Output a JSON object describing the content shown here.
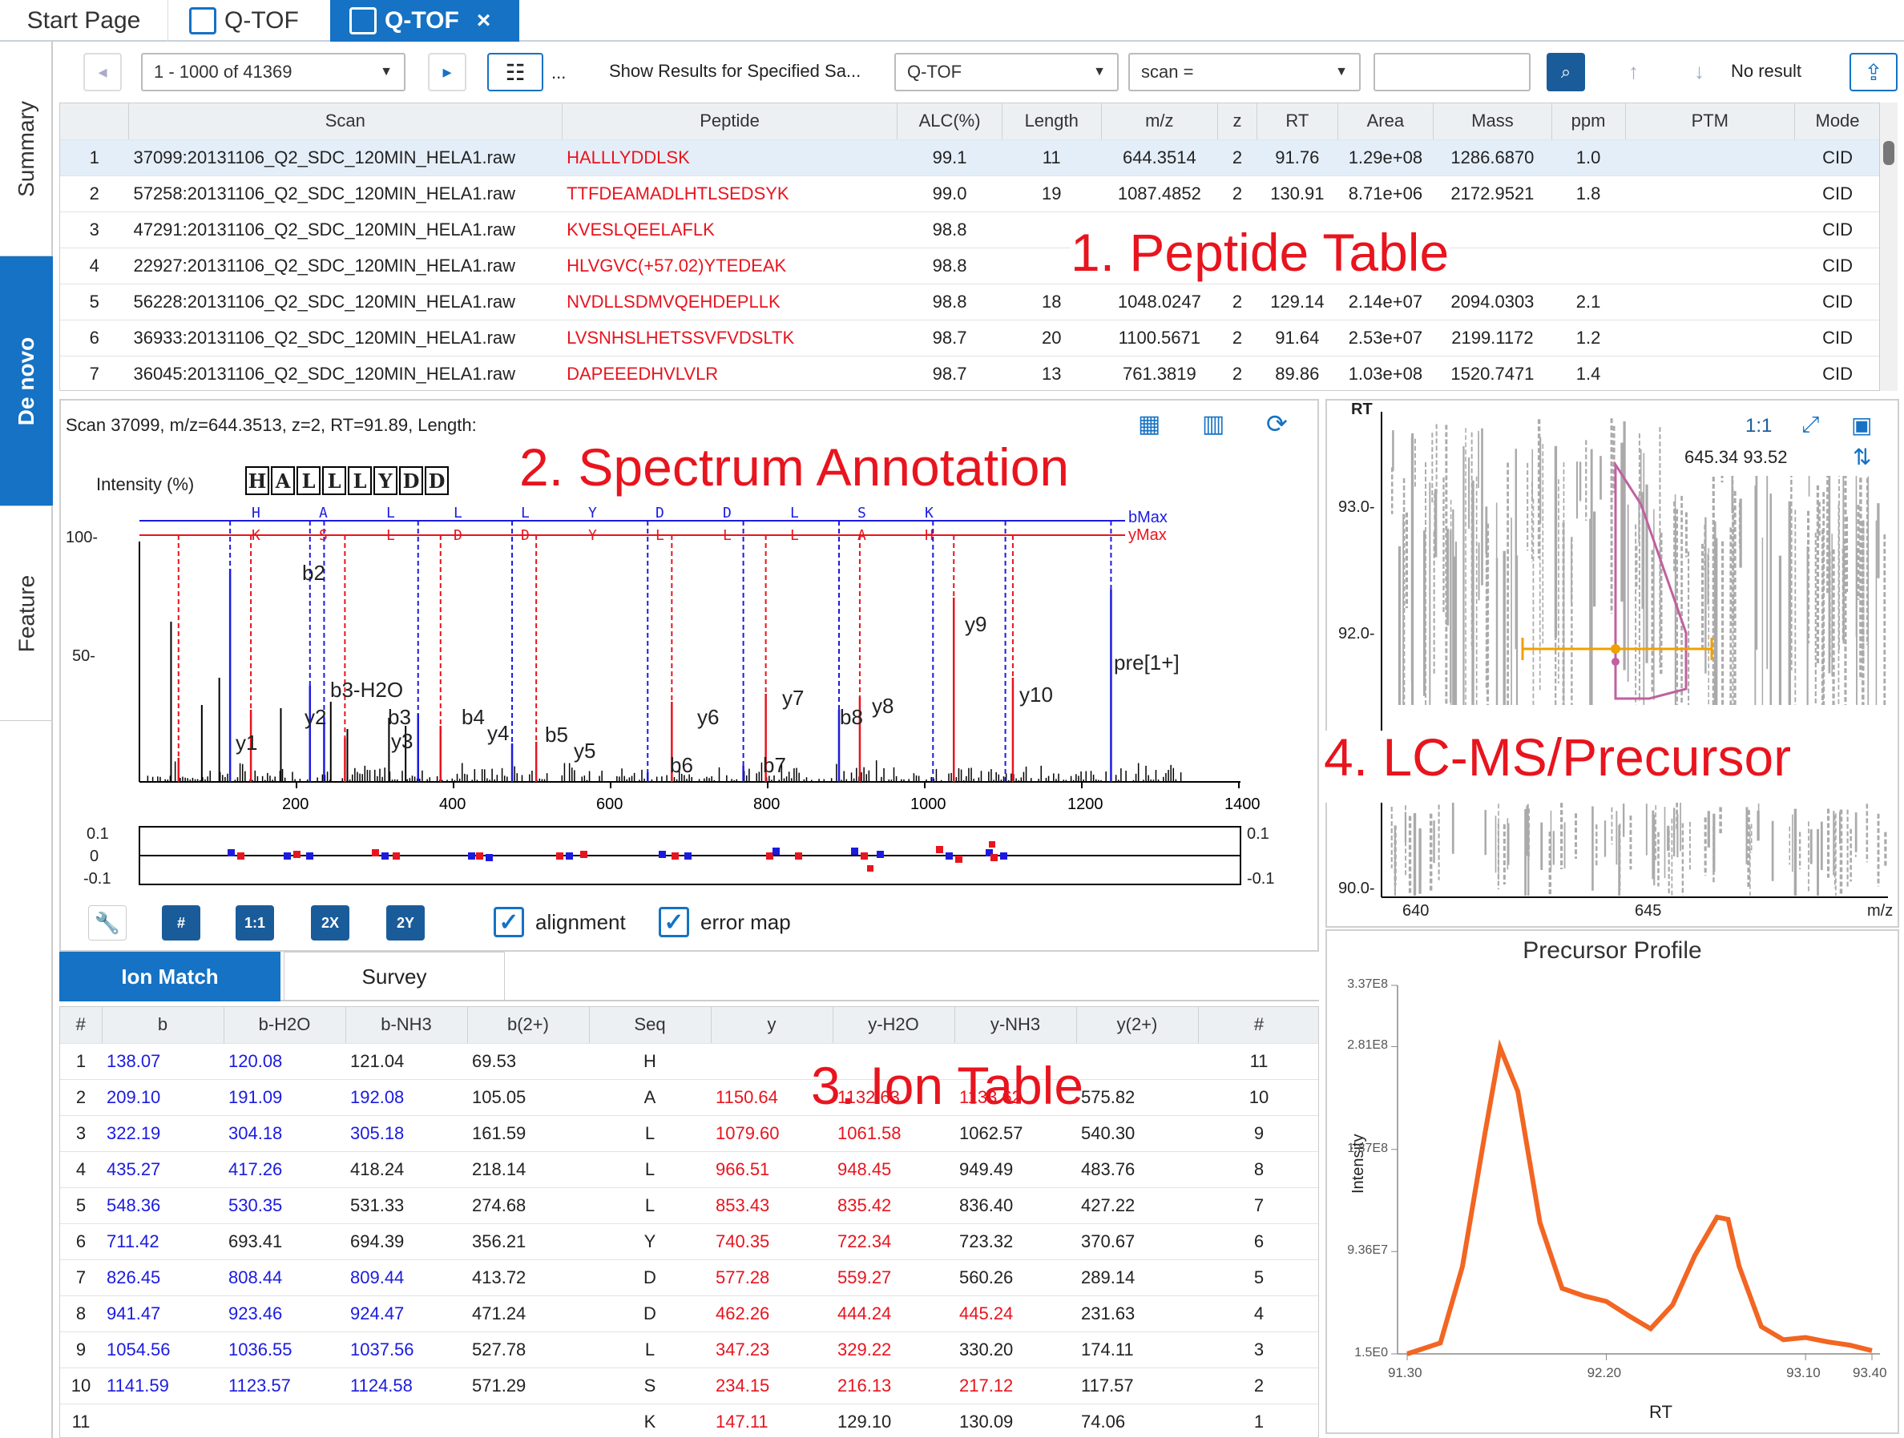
{
  "tabs": {
    "start": "Start Page",
    "qtof1": "Q-TOF",
    "qtof2": "Q-TOF",
    "close": "×"
  },
  "side": {
    "summary": "Summary",
    "denovo": "De novo",
    "feature": "Feature"
  },
  "toolbar": {
    "range": "1 - 1000 of 41369",
    "ellipsis": "...",
    "show_results": "Show Results for Specified Sa...",
    "sample": "Q-TOF",
    "filter": "scan =",
    "filter_value": "",
    "no_result": "No result"
  },
  "peptide_table": {
    "headers": [
      "",
      "Scan",
      "Peptide",
      "ALC(%)",
      "Length",
      "m/z",
      "z",
      "RT",
      "Area",
      "Mass",
      "ppm",
      "PTM",
      "Mode"
    ],
    "rows": [
      [
        "1",
        "37099:20131106_Q2_SDC_120MIN_HELA1.raw",
        "HALLLYDDLSK",
        "99.1",
        "11",
        "644.3514",
        "2",
        "91.76",
        "1.29e+08",
        "1286.6870",
        "1.0",
        "",
        "CID"
      ],
      [
        "2",
        "57258:20131106_Q2_SDC_120MIN_HELA1.raw",
        "TTFDEAMADLHTLSEDSYK",
        "99.0",
        "19",
        "1087.4852",
        "2",
        "130.91",
        "8.71e+06",
        "2172.9521",
        "1.8",
        "",
        "CID"
      ],
      [
        "3",
        "47291:20131106_Q2_SDC_120MIN_HELA1.raw",
        "KVESLQEELAFLK",
        "98.8",
        "",
        "",
        "",
        "",
        "",
        "",
        "",
        "",
        "CID"
      ],
      [
        "4",
        "22927:20131106_Q2_SDC_120MIN_HELA1.raw",
        "HLVGVC(+57.02)YTEDEAK",
        "98.8",
        "",
        "",
        "",
        "",
        "",
        "",
        "",
        "",
        "CID"
      ],
      [
        "5",
        "56228:20131106_Q2_SDC_120MIN_HELA1.raw",
        "NVDLLSDMVQEHDEPLLK",
        "98.8",
        "18",
        "1048.0247",
        "2",
        "129.14",
        "2.14e+07",
        "2094.0303",
        "2.1",
        "",
        "CID"
      ],
      [
        "6",
        "36933:20131106_Q2_SDC_120MIN_HELA1.raw",
        "LVSNHSLHETSSVFVDSLTK",
        "98.7",
        "20",
        "1100.5671",
        "2",
        "91.64",
        "2.53e+07",
        "2199.1172",
        "1.2",
        "",
        "CID"
      ],
      [
        "7",
        "36045:20131106_Q2_SDC_120MIN_HELA1.raw",
        "DAPEEEDHVLVLR",
        "98.7",
        "13",
        "761.3819",
        "2",
        "89.86",
        "1.03e+08",
        "1520.7471",
        "1.4",
        "",
        "CID"
      ]
    ]
  },
  "labels": {
    "peptide_table": "1. Peptide Table",
    "spectrum": "2. Spectrum Annotation",
    "ion_table": "3. Ion Table",
    "lcms": "4. LC-MS/Precursor"
  },
  "spectrum": {
    "header": "Scan 37099, m/z=644.3513, z=2, RT=91.89, Length:",
    "intensity_label": "Intensity (%)",
    "sequence": [
      "H",
      "A",
      "L",
      "L",
      "L",
      "Y",
      "D",
      "D"
    ],
    "b_seq": [
      "H",
      "A",
      "L",
      "L",
      "L",
      "Y",
      "D",
      "D",
      "L",
      "S",
      "K"
    ],
    "y_seq": [
      "K",
      "S",
      "L",
      "D",
      "D",
      "Y",
      "L",
      "L",
      "L",
      "A",
      "H"
    ],
    "bmax": "bMax",
    "ymax": "yMax",
    "yticks": [
      "100-",
      "50-"
    ],
    "xticks": [
      "200",
      "400",
      "600",
      "800",
      "1000",
      "1200",
      "1400"
    ],
    "err_ticks": [
      "0.1",
      "0",
      "-0.1"
    ],
    "err_ticks_r": [
      "0.1",
      "-0.1"
    ],
    "ion_labels": {
      "b2": "b2",
      "b3h2o": "b3-H2O",
      "b3": "b3",
      "b4": "b4",
      "b5": "b5",
      "b6": "b6",
      "b7": "b7",
      "b8": "b8",
      "y1": "y1",
      "y2": "y2",
      "y3": "y3",
      "y4": "y4",
      "y5": "y5",
      "y6": "y6",
      "y7": "y7",
      "y8": "y8",
      "y9": "y9",
      "y10": "y10",
      "pre": "pre[1+]"
    },
    "buttons": {
      "hash": "#",
      "one": "1:1",
      "twox": "2X",
      "twoy": "2Y"
    },
    "alignment": "alignment",
    "errormap": "error map"
  },
  "ion_tabs": {
    "ion_match": "Ion Match",
    "survey": "Survey"
  },
  "ion_table": {
    "headers": [
      "#",
      "b",
      "b-H2O",
      "b-NH3",
      "b(2+)",
      "Seq",
      "y",
      "y-H2O",
      "y-NH3",
      "y(2+)",
      "#"
    ],
    "rows": [
      [
        "1",
        "138.07",
        "120.08",
        "121.04",
        "69.53",
        "H",
        "",
        "",
        "",
        "",
        "11"
      ],
      [
        "2",
        "209.10",
        "191.09",
        "192.08",
        "105.05",
        "A",
        "1150.64",
        "1132.63",
        "1133.62",
        "575.82",
        "10"
      ],
      [
        "3",
        "322.19",
        "304.18",
        "305.18",
        "161.59",
        "L",
        "1079.60",
        "1061.58",
        "1062.57",
        "540.30",
        "9"
      ],
      [
        "4",
        "435.27",
        "417.26",
        "418.24",
        "218.14",
        "L",
        "966.51",
        "948.45",
        "949.49",
        "483.76",
        "8"
      ],
      [
        "5",
        "548.36",
        "530.35",
        "531.33",
        "274.68",
        "L",
        "853.43",
        "835.42",
        "836.40",
        "427.22",
        "7"
      ],
      [
        "6",
        "711.42",
        "693.41",
        "694.39",
        "356.21",
        "Y",
        "740.35",
        "722.34",
        "723.32",
        "370.67",
        "6"
      ],
      [
        "7",
        "826.45",
        "808.44",
        "809.44",
        "413.72",
        "D",
        "577.28",
        "559.27",
        "560.26",
        "289.14",
        "5"
      ],
      [
        "8",
        "941.47",
        "923.46",
        "924.47",
        "471.24",
        "D",
        "462.26",
        "444.24",
        "445.24",
        "231.63",
        "4"
      ],
      [
        "9",
        "1054.56",
        "1036.55",
        "1037.56",
        "527.78",
        "L",
        "347.23",
        "329.22",
        "330.20",
        "174.11",
        "3"
      ],
      [
        "10",
        "1141.59",
        "1123.57",
        "1124.58",
        "571.29",
        "S",
        "234.15",
        "216.13",
        "217.12",
        "117.57",
        "2"
      ],
      [
        "11",
        "",
        "",
        "",
        "",
        "K",
        "147.11",
        "129.10",
        "130.09",
        "74.06",
        "1"
      ]
    ]
  },
  "lcms": {
    "rt_label": "RT",
    "ratio": "1:1",
    "coords": "645.34 93.52",
    "yticks": [
      "93.0-",
      "92.0-",
      "90.0-"
    ],
    "xticks": [
      "640",
      "645"
    ],
    "mz": "m/z"
  },
  "profile": {
    "title": "Precursor Profile",
    "ylabel": "Intensity",
    "xlabel": "RT",
    "yticks": [
      "3.37E8",
      "2.81E8",
      "1.87E8",
      "9.36E7",
      "1.5E0"
    ],
    "xticks": [
      "91.30",
      "92.20",
      "93.10",
      "93.40"
    ]
  },
  "chart_data": {
    "type": "line",
    "title": "Precursor Profile",
    "xlabel": "RT",
    "ylabel": "Intensity",
    "x": [
      91.3,
      91.45,
      91.55,
      91.65,
      91.72,
      91.8,
      91.9,
      92.0,
      92.1,
      92.2,
      92.3,
      92.4,
      92.5,
      92.6,
      92.7,
      92.75,
      92.8,
      92.9,
      93.0,
      93.1,
      93.2,
      93.3,
      93.4
    ],
    "y": [
      1.5,
      10000000.0,
      80000000.0,
      200000000.0,
      280000000.0,
      240000000.0,
      120000000.0,
      60000000.0,
      53000000.0,
      48000000.0,
      35000000.0,
      23000000.0,
      45000000.0,
      90000000.0,
      125000000.0,
      123000000.0,
      80000000.0,
      25000000.0,
      13000000.0,
      15000000.0,
      11000000.0,
      8000000.0,
      3000000.0
    ],
    "xlim": [
      91.3,
      93.4
    ],
    "ylim": [
      1.5,
      337000000.0
    ]
  },
  "colors": {
    "accent": "#1572c4",
    "red": "#e8141e",
    "blue": "#1b1be0",
    "profile": "#f26522"
  }
}
